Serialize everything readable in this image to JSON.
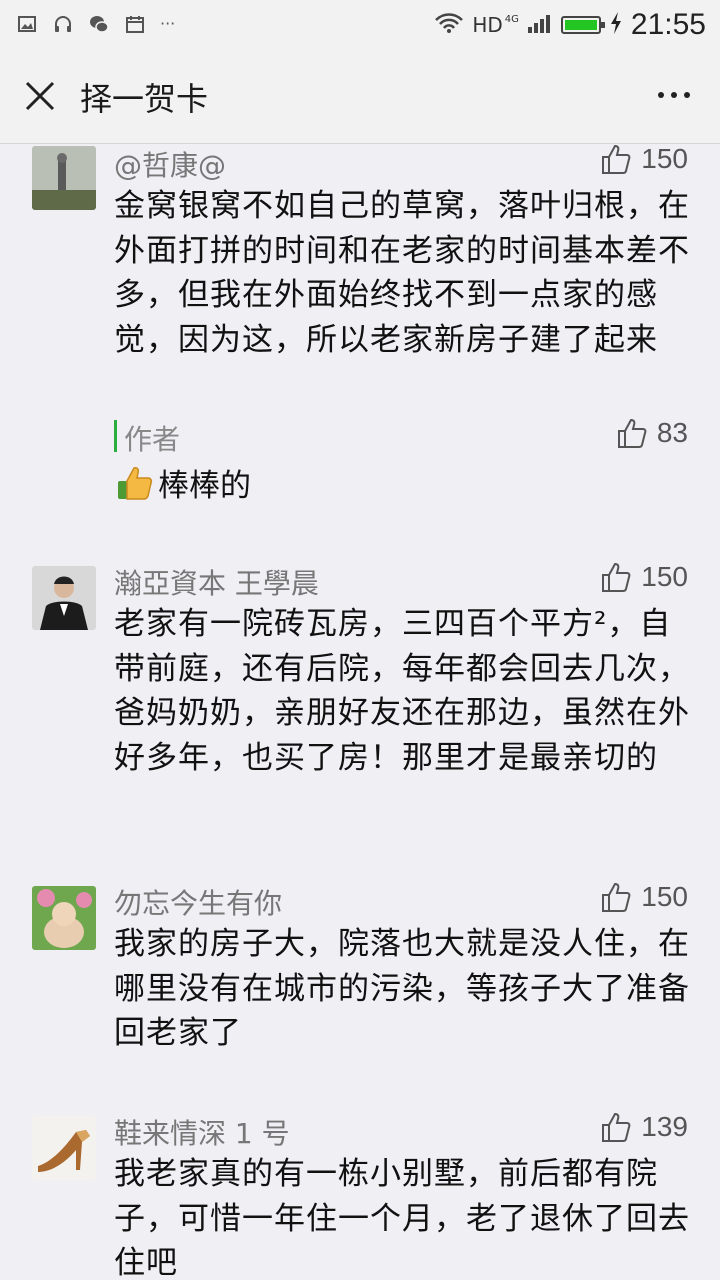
{
  "status_bar": {
    "network": "HD",
    "network_gen": "4G",
    "battery_level": 1.0,
    "time": "21:55"
  },
  "nav": {
    "title": "择一贺卡"
  },
  "comments": [
    {
      "name": "@哲康@",
      "likes": "150",
      "text": "金窝银窝不如自己的草窝，落叶归根，在外面打拼的时间和在老家的时间基本差不多，但我在外面始终找不到一点家的感觉，因为这，所以老家新房子建了起来",
      "author_reply": {
        "label": "作者",
        "likes": "83",
        "text": "棒棒的"
      }
    },
    {
      "name": "瀚亞資本 王學晨",
      "likes": "150",
      "text": "老家有一院砖瓦房，三四百个平方²，自带前庭，还有后院，每年都会回去几次，爸妈奶奶，亲朋好友还在那边，虽然在外好多年，也买了房！那里才是最亲切的"
    },
    {
      "name": "勿忘今生有你",
      "likes": "150",
      "text": "我家的房子大，院落也大就是没人住，在哪里没有在城市的污染，等孩子大了准备回老家了"
    },
    {
      "name": "鞋来情深 1 号",
      "likes": "139",
      "text": "我老家真的有一栋小别墅，前后都有院子，可惜一年住一个月，老了退休了回去住吧"
    }
  ]
}
